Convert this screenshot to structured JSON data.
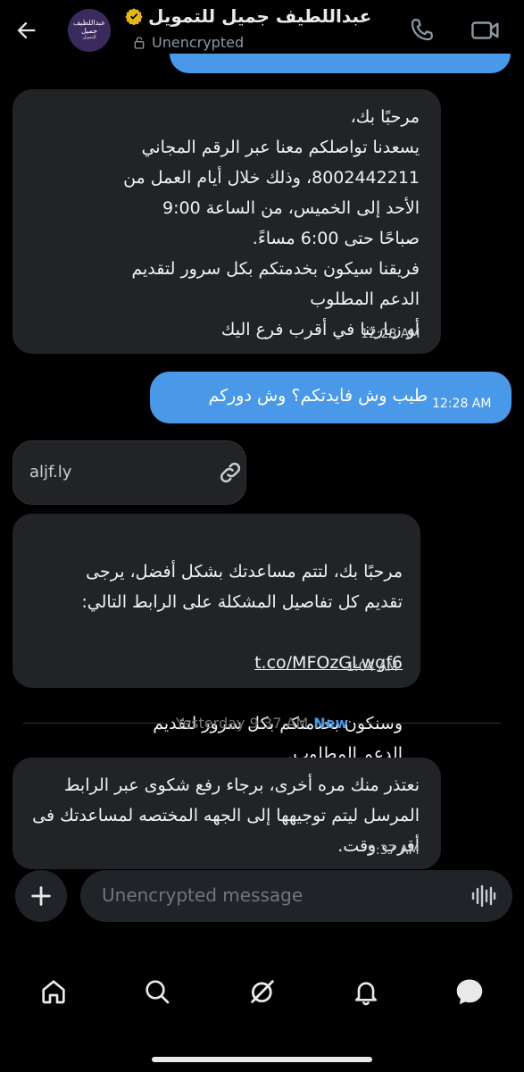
{
  "header": {
    "title": "عبداللطيف جميل للتمويل",
    "status": "Unencrypted",
    "avatar_logo_text": "عبداللطيف جميل",
    "avatar_logo_sub": "للتمويل",
    "icons": [
      "back-arrow-icon",
      "verified-badge-icon",
      "lock-icon",
      "phone-icon",
      "video-camera-icon"
    ]
  },
  "messages": [
    {
      "direction": "incoming",
      "text": "مرحبًا بك،\nيسعدنا تواصلكم معنا عبر الرقم المجاني 8002442211، وذلك خلال أيام العمل من الأحد إلى الخميس، من الساعة 9:00 صباحًا حتى 6:00 مساءً.\nفريقنا سيكون بخدمتكم بكل سرور لتقديم الدعم المطلوب\nأو زيارتنا في أقرب فرع اليك",
      "time": "12:28 AM"
    },
    {
      "direction": "outgoing",
      "text": "طيب وش فايدتكم؟ وش دوركم",
      "time": "12:28 AM"
    },
    {
      "direction": "incoming",
      "link_card": "aljf.ly"
    },
    {
      "direction": "incoming",
      "text_before": "مرحبًا بك، لتتم مساعدتك بشكل أفضل، يرجى تقديم كل تفاصيل المشكلة على الرابط التالي:",
      "link": "t.co/MFOzGLwgf6",
      "text_after": "وسنكون بخدمتكم بكل سرور لتقديم الدعم المطلوب.",
      "time": "1:04 AM"
    },
    {
      "direction": "incoming",
      "text": "نعتذر منك مره أخرى، برجاء رفع شكوى عبر الرابط المرسل ليتم توجيهها إلى الجهه المختصه لمساعدتك فى أقرب وقت.",
      "time": "9:37 AM"
    }
  ],
  "divider": {
    "label": "Yesterday 9:37 AM",
    "new_label": "New"
  },
  "composer": {
    "placeholder": "Unencrypted message",
    "icons": [
      "plus-icon",
      "voice-waveform-icon"
    ]
  },
  "nav": {
    "items": [
      "home-icon",
      "search-icon",
      "grok-icon",
      "notifications-icon",
      "messages-icon"
    ]
  },
  "colors": {
    "background": "#000000",
    "incoming_bubble": "#212326",
    "outgoing_bubble": "#4a99e9",
    "accent": "#4a99e9",
    "muted": "#71767b",
    "verified": "#e2b719"
  }
}
